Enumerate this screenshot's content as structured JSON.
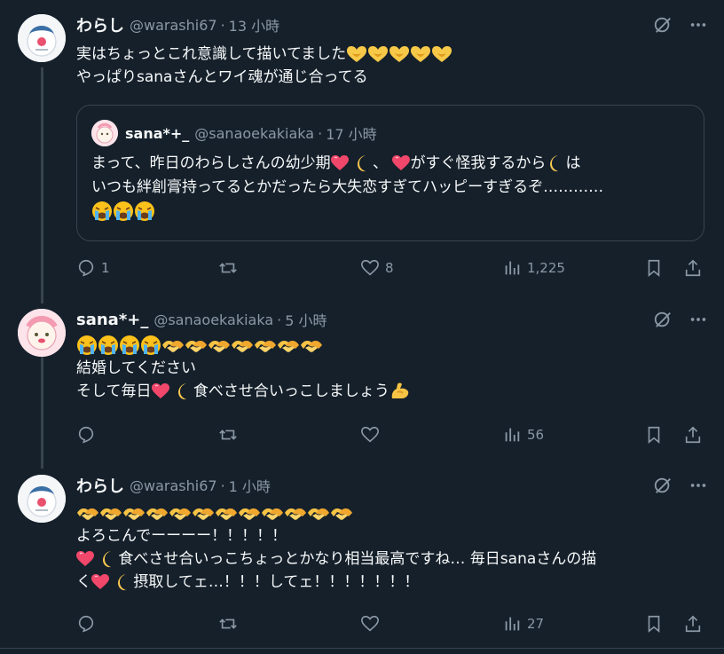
{
  "tweets": [
    {
      "name": "わらし",
      "handle": "@warashi67",
      "sep": "·",
      "time": "13 小時",
      "lines": [
        "実はちょっとこれ意識して描いてました",
        "やっぱりsanaさんとワイ魂が通じ合ってる"
      ],
      "quote": {
        "name": "sana*+_",
        "handle": "@sanaoekakiaka",
        "sep": "·",
        "time": "17 小時",
        "line1a": "まって、昨日のわらしさんの幼少期",
        "line1b": "、",
        "line1c": "がすぐ怪我するから",
        "line1d": "は",
        "line2": "いつも絆創膏持ってるとかだったら大失恋すぎてハッピーすぎるぞ…………"
      },
      "actions": {
        "reply": "1",
        "retweet": "",
        "like": "8",
        "views": "1,225"
      }
    },
    {
      "name": "sana*+_",
      "handle": "@sanaoekakiaka",
      "sep": "·",
      "time": "5 小時",
      "line2": "結婚してください",
      "line3a": "そして毎日",
      "line3b": "食べさせ合いっこしましょう",
      "actions": {
        "reply": "",
        "retweet": "",
        "like": "",
        "views": "56"
      }
    },
    {
      "name": "わらし",
      "handle": "@warashi67",
      "sep": "·",
      "time": "1 小時",
      "line2": "よろこんでーーーー！！！！！",
      "line3": "食べさせ合いっこちょっとかなり相当最高ですね… 毎日sanaさんの描",
      "line4a": "く",
      "line4b": "摂取してェ…！！！してェ！！！！！！！",
      "actions": {
        "reply": "",
        "retweet": "",
        "like": "",
        "views": "27"
      }
    }
  ],
  "icons": [
    "grok-icon",
    "more-icon",
    "reply-icon",
    "retweet-icon",
    "like-icon",
    "views-icon",
    "bookmark-icon",
    "share-icon"
  ],
  "colors": {
    "background": "#15202b",
    "text": "#f7f9f9",
    "muted": "#8b98a5",
    "border": "#38444d"
  }
}
